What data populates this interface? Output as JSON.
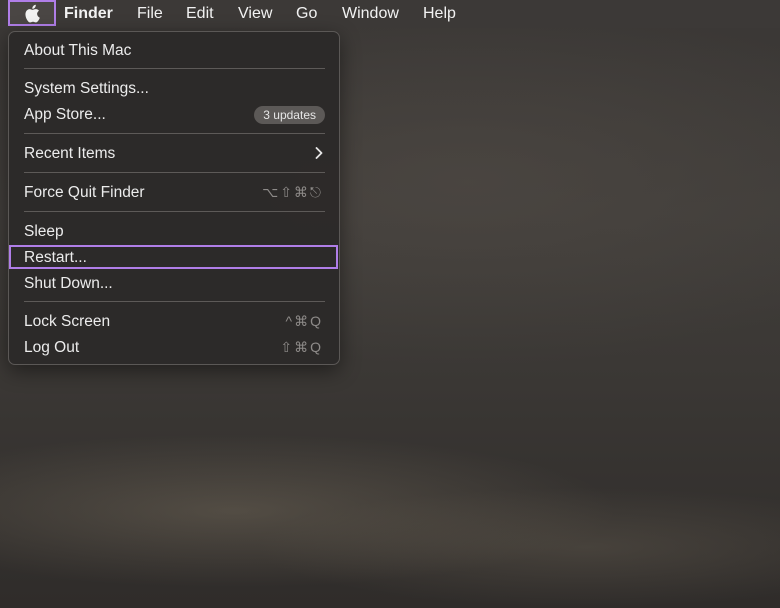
{
  "menubar": {
    "apple_icon": "apple-logo-icon",
    "app_name": "Finder",
    "items": [
      "File",
      "Edit",
      "View",
      "Go",
      "Window",
      "Help"
    ]
  },
  "apple_menu": {
    "about": "About This Mac",
    "system_settings": "System Settings...",
    "app_store": "App Store...",
    "app_store_badge": "3 updates",
    "recent_items": "Recent Items",
    "force_quit": "Force Quit Finder",
    "force_quit_shortcut": "⌥⇧⌘⎋",
    "sleep": "Sleep",
    "restart": "Restart...",
    "shut_down": "Shut Down...",
    "lock_screen": "Lock Screen",
    "lock_screen_shortcut": "^⌘Q",
    "log_out": "Log Out",
    "log_out_shortcut": "⇧⌘Q"
  },
  "colors": {
    "highlight": "#b07ee8",
    "menu_bg": "#2c2a29"
  }
}
